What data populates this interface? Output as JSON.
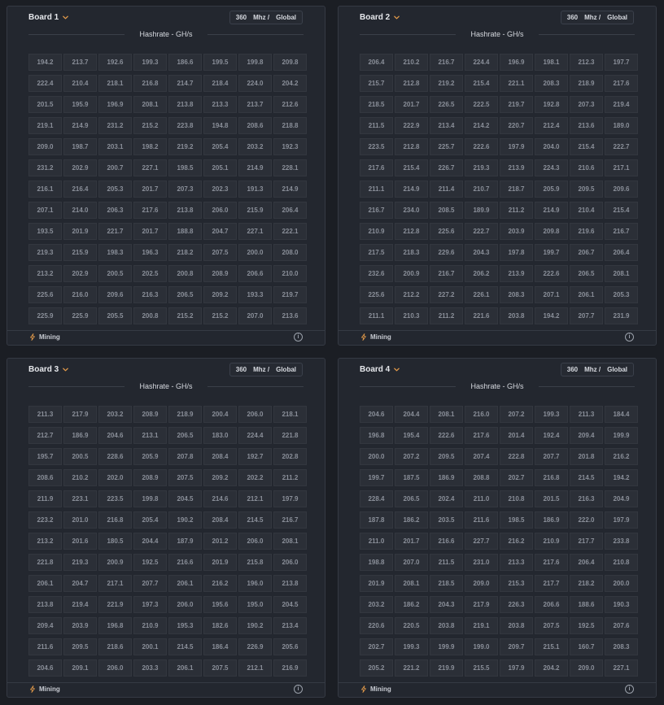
{
  "colors": {
    "accent": "#e29a4a",
    "panel": "#23272f",
    "cell": "#2b2f37"
  },
  "common": {
    "frequency": "360",
    "frequency_unit": "Mhz /",
    "mode": "Global",
    "subtitle": "Hashrate - GH/s",
    "status": "Mining",
    "status_icon": "bolt-icon",
    "info_icon": "info-icon",
    "info_glyph": "i"
  },
  "boards": [
    {
      "name": "Board 1",
      "cells": [
        [
          "194.2",
          "213.7",
          "192.6",
          "199.3",
          "186.6",
          "199.5",
          "199.8",
          "209.8"
        ],
        [
          "222.4",
          "210.4",
          "218.1",
          "216.8",
          "214.7",
          "218.4",
          "224.0",
          "204.2"
        ],
        [
          "201.5",
          "195.9",
          "196.9",
          "208.1",
          "213.8",
          "213.3",
          "213.7",
          "212.6"
        ],
        [
          "219.1",
          "214.9",
          "231.2",
          "215.2",
          "223.8",
          "194.8",
          "208.6",
          "218.8"
        ],
        [
          "209.0",
          "198.7",
          "203.1",
          "198.2",
          "219.2",
          "205.4",
          "203.2",
          "192.3"
        ],
        [
          "231.2",
          "202.9",
          "200.7",
          "227.1",
          "198.5",
          "205.1",
          "214.9",
          "228.1"
        ],
        [
          "216.1",
          "216.4",
          "205.3",
          "201.7",
          "207.3",
          "202.3",
          "191.3",
          "214.9"
        ],
        [
          "207.1",
          "214.0",
          "206.3",
          "217.6",
          "213.8",
          "206.0",
          "215.9",
          "206.4"
        ],
        [
          "193.5",
          "201.9",
          "221.7",
          "201.7",
          "188.8",
          "204.7",
          "227.1",
          "222.1"
        ],
        [
          "219.3",
          "215.9",
          "198.3",
          "196.3",
          "218.2",
          "207.5",
          "200.0",
          "208.0"
        ],
        [
          "213.2",
          "202.9",
          "200.5",
          "202.5",
          "200.8",
          "208.9",
          "206.6",
          "210.0"
        ],
        [
          "225.6",
          "216.0",
          "209.6",
          "216.3",
          "206.5",
          "209.2",
          "193.3",
          "219.7"
        ],
        [
          "225.9",
          "225.9",
          "205.5",
          "200.8",
          "215.2",
          "215.2",
          "207.0",
          "213.6"
        ]
      ]
    },
    {
      "name": "Board 2",
      "cells": [
        [
          "206.4",
          "210.2",
          "216.7",
          "224.4",
          "196.9",
          "198.1",
          "212.3",
          "197.7"
        ],
        [
          "215.7",
          "212.8",
          "219.2",
          "215.4",
          "221.1",
          "208.3",
          "218.9",
          "217.6"
        ],
        [
          "218.5",
          "201.7",
          "226.5",
          "222.5",
          "219.7",
          "192.8",
          "207.3",
          "219.4"
        ],
        [
          "211.5",
          "222.9",
          "213.4",
          "214.2",
          "220.7",
          "212.4",
          "213.6",
          "189.0"
        ],
        [
          "223.5",
          "212.8",
          "225.7",
          "222.6",
          "197.9",
          "204.0",
          "215.4",
          "222.7"
        ],
        [
          "217.6",
          "215.4",
          "226.7",
          "219.3",
          "213.9",
          "224.3",
          "210.6",
          "217.1"
        ],
        [
          "211.1",
          "214.9",
          "211.4",
          "210.7",
          "218.7",
          "205.9",
          "209.5",
          "209.6"
        ],
        [
          "216.7",
          "234.0",
          "208.5",
          "189.9",
          "211.2",
          "214.9",
          "210.4",
          "215.4"
        ],
        [
          "210.9",
          "212.8",
          "225.6",
          "222.7",
          "203.9",
          "209.8",
          "219.6",
          "216.7"
        ],
        [
          "217.5",
          "218.3",
          "229.6",
          "204.3",
          "197.8",
          "199.7",
          "206.7",
          "206.4"
        ],
        [
          "232.6",
          "200.9",
          "216.7",
          "206.2",
          "213.9",
          "222.6",
          "206.5",
          "208.1"
        ],
        [
          "225.6",
          "212.2",
          "227.2",
          "226.1",
          "208.3",
          "207.1",
          "206.1",
          "205.3"
        ],
        [
          "211.1",
          "210.3",
          "211.2",
          "221.6",
          "203.8",
          "194.2",
          "207.7",
          "231.9"
        ]
      ]
    },
    {
      "name": "Board 3",
      "cells": [
        [
          "211.3",
          "217.9",
          "203.2",
          "208.9",
          "218.9",
          "200.4",
          "206.0",
          "218.1"
        ],
        [
          "212.7",
          "186.9",
          "204.6",
          "213.1",
          "206.5",
          "183.0",
          "224.4",
          "221.8"
        ],
        [
          "195.7",
          "200.5",
          "228.6",
          "205.9",
          "207.8",
          "208.4",
          "192.7",
          "202.8"
        ],
        [
          "208.6",
          "210.2",
          "202.0",
          "208.9",
          "207.5",
          "209.2",
          "202.2",
          "211.2"
        ],
        [
          "211.9",
          "223.1",
          "223.5",
          "199.8",
          "204.5",
          "214.6",
          "212.1",
          "197.9"
        ],
        [
          "223.2",
          "201.0",
          "216.8",
          "205.4",
          "190.2",
          "208.4",
          "214.5",
          "216.7"
        ],
        [
          "213.2",
          "201.6",
          "180.5",
          "204.4",
          "187.9",
          "201.2",
          "206.0",
          "208.1"
        ],
        [
          "221.8",
          "219.3",
          "200.9",
          "192.5",
          "216.6",
          "201.9",
          "215.8",
          "206.0"
        ],
        [
          "206.1",
          "204.7",
          "217.1",
          "207.7",
          "206.1",
          "216.2",
          "196.0",
          "213.8"
        ],
        [
          "213.8",
          "219.4",
          "221.9",
          "197.3",
          "206.0",
          "195.6",
          "195.0",
          "204.5"
        ],
        [
          "209.4",
          "203.9",
          "196.8",
          "210.9",
          "195.3",
          "182.6",
          "190.2",
          "213.4"
        ],
        [
          "211.6",
          "209.5",
          "218.6",
          "200.1",
          "214.5",
          "186.4",
          "226.9",
          "205.6"
        ],
        [
          "204.6",
          "209.1",
          "206.0",
          "203.3",
          "206.1",
          "207.5",
          "212.1",
          "216.9"
        ]
      ]
    },
    {
      "name": "Board 4",
      "cells": [
        [
          "204.6",
          "204.4",
          "208.1",
          "216.0",
          "207.2",
          "199.3",
          "211.3",
          "184.4"
        ],
        [
          "196.8",
          "195.4",
          "222.6",
          "217.6",
          "201.4",
          "192.4",
          "209.4",
          "199.9"
        ],
        [
          "200.0",
          "207.2",
          "209.5",
          "207.4",
          "222.8",
          "207.7",
          "201.8",
          "216.2"
        ],
        [
          "199.7",
          "187.5",
          "186.9",
          "208.8",
          "202.7",
          "216.8",
          "214.5",
          "194.2"
        ],
        [
          "228.4",
          "206.5",
          "202.4",
          "211.0",
          "210.8",
          "201.5",
          "216.3",
          "204.9"
        ],
        [
          "187.8",
          "186.2",
          "203.5",
          "211.6",
          "198.5",
          "186.9",
          "222.0",
          "197.9"
        ],
        [
          "211.0",
          "201.7",
          "216.6",
          "227.7",
          "216.2",
          "210.9",
          "217.7",
          "233.8"
        ],
        [
          "198.8",
          "207.0",
          "211.5",
          "231.0",
          "213.3",
          "217.6",
          "206.4",
          "210.8"
        ],
        [
          "201.9",
          "208.1",
          "218.5",
          "209.0",
          "215.3",
          "217.7",
          "218.2",
          "200.0"
        ],
        [
          "203.2",
          "186.2",
          "204.3",
          "217.9",
          "226.3",
          "206.6",
          "188.6",
          "190.3"
        ],
        [
          "220.6",
          "220.5",
          "203.8",
          "219.1",
          "203.8",
          "207.5",
          "192.5",
          "207.6"
        ],
        [
          "202.7",
          "199.3",
          "199.9",
          "199.0",
          "209.7",
          "215.1",
          "160.7",
          "208.3"
        ],
        [
          "205.2",
          "221.2",
          "219.9",
          "215.5",
          "197.9",
          "204.2",
          "209.0",
          "227.1"
        ]
      ]
    }
  ]
}
